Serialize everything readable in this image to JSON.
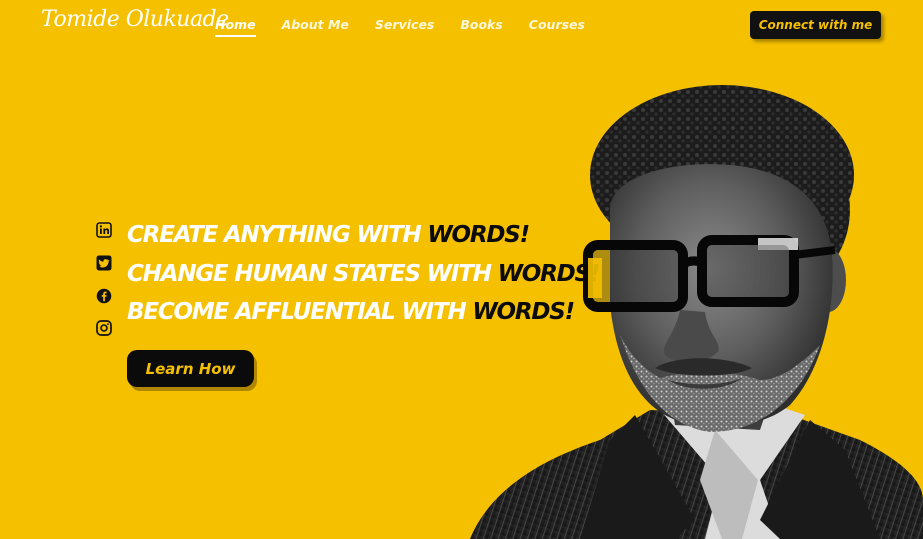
{
  "brand": {
    "logo_text": "Tomide Olukuade"
  },
  "nav": {
    "items": [
      {
        "label": "Home",
        "active": true
      },
      {
        "label": "About Me"
      },
      {
        "label": "Services"
      },
      {
        "label": "Books"
      },
      {
        "label": "Courses"
      }
    ]
  },
  "header": {
    "connect_label": "Connect with me"
  },
  "socials": [
    {
      "icon": "linkedin-icon"
    },
    {
      "icon": "twitter-icon"
    },
    {
      "icon": "facebook-icon"
    },
    {
      "icon": "instagram-icon"
    }
  ],
  "hero": {
    "lines": [
      {
        "text": "CREATE ANYTHING WITH ",
        "accent": "WORDS!"
      },
      {
        "text": "CHANGE HUMAN STATES WITH ",
        "accent": "WORDS!"
      },
      {
        "text": "BECOME AFFLUENTIAL WITH ",
        "accent": "WORDS!"
      }
    ],
    "cta_label": "Learn How"
  },
  "colors": {
    "background": "#F5C000",
    "accent_dark": "#0b0b0b",
    "text_light": "#ffffff"
  }
}
